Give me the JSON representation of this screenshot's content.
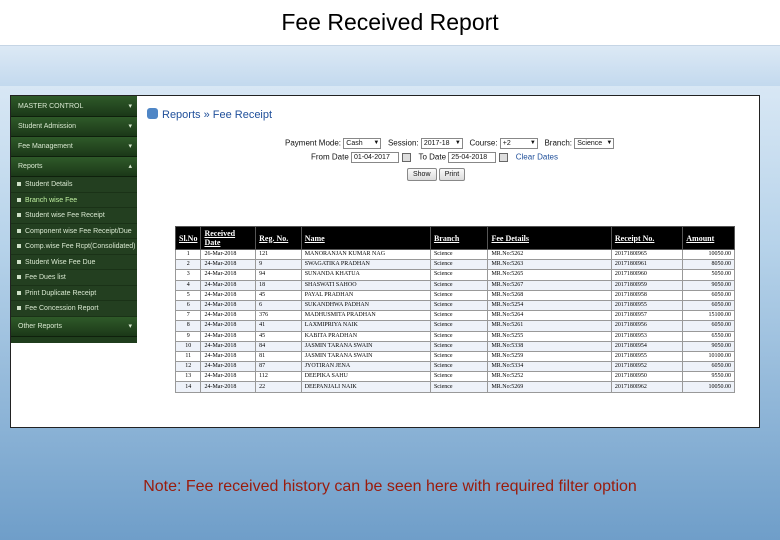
{
  "slide": {
    "title": "Fee Received Report",
    "note": "Note: Fee received history can be seen here with required filter option"
  },
  "sidebar": {
    "sections": [
      {
        "label": "MASTER CONTROL"
      },
      {
        "label": "Student Admission"
      },
      {
        "label": "Fee Management"
      },
      {
        "label": "Reports"
      }
    ],
    "report_items": [
      "Student Details",
      "Branch wise Fee",
      "Student wise Fee Receipt",
      "Component wise Fee Receipt/Due",
      "Comp.wise Fee Rcpt(Consolidated)",
      "Student Wise Fee Due",
      "Fee Dues list",
      "Print Duplicate Receipt",
      "Fee Concession Report"
    ],
    "other": "Other Reports"
  },
  "breadcrumb": "Reports » Fee Receipt",
  "filters": {
    "payment_mode_label": "Payment Mode:",
    "payment_mode_value": "Cash",
    "session_label": "Session:",
    "session_value": "2017-18",
    "course_label": "Course:",
    "course_value": "+2",
    "branch_label": "Branch:",
    "branch_value": "Science",
    "from_date_label": "From Date",
    "from_date_value": "01-04-2017",
    "to_date_label": "To Date",
    "to_date_value": "25-04-2018",
    "clear_dates": "Clear Dates",
    "show_button": "Show",
    "print_button": "Print"
  },
  "table": {
    "headers": [
      "Sl.No",
      "Received Date",
      "Reg. No.",
      "Name",
      "Branch",
      "Fee Details",
      "Receipt No.",
      "Amount"
    ],
    "rows": [
      [
        "1",
        "26-Mar-2018",
        "121",
        "MANORANJAN KUMAR NAG",
        "Science",
        "MR.No:5262",
        "2017180I965",
        "10050.00"
      ],
      [
        "2",
        "24-Mar-2018",
        "9",
        "SWAGATIKA PRADHAN",
        "Science",
        "MR.No:5263",
        "2017180I961",
        "8050.00"
      ],
      [
        "3",
        "24-Mar-2018",
        "94",
        "SUNANDA KHATUA",
        "Science",
        "MR.No:5265",
        "2017180I960",
        "5050.00"
      ],
      [
        "4",
        "24-Mar-2018",
        "18",
        "SHASWATI SAHOO",
        "Science",
        "MR.No:5267",
        "2017180I959",
        "9050.00"
      ],
      [
        "5",
        "24-Mar-2018",
        "45",
        "PAYAL PRADHAN",
        "Science",
        "MR.No:5268",
        "2017180I958",
        "6050.00"
      ],
      [
        "6",
        "24-Mar-2018",
        "6",
        "SUKANDHWA PADHAN",
        "Science",
        "MR.No:5254",
        "2017180I955",
        "6050.00"
      ],
      [
        "7",
        "24-Mar-2018",
        "376",
        "MADHUSMITA PRADHAN",
        "Science",
        "MR.No:5264",
        "2017180I957",
        "15100.00"
      ],
      [
        "8",
        "24-Mar-2018",
        "41",
        "LAXMIPRIYA NAIK",
        "Science",
        "MR.No:5261",
        "2017180I956",
        "6050.00"
      ],
      [
        "9",
        "24-Mar-2018",
        "45",
        "KABITA PRADHAN",
        "Science",
        "MR.No:5255",
        "2017180I953",
        "6550.00"
      ],
      [
        "10",
        "24-Mar-2018",
        "84",
        "JASMIN TARANA SWAIN",
        "Science",
        "MR.No:5338",
        "2017180I954",
        "9050.00"
      ],
      [
        "11",
        "24-Mar-2018",
        "81",
        "JASMIN TARANA SWAIN",
        "Science",
        "MR.No:5259",
        "2017180I955",
        "10100.00"
      ],
      [
        "12",
        "24-Mar-2018",
        "87",
        "JYOTIRAN JENA",
        "Science",
        "MR.No:5334",
        "2017180I952",
        "6050.00"
      ],
      [
        "13",
        "24-Mar-2018",
        "112",
        "DEEPIKA SAHU",
        "Science",
        "MR.No:5252",
        "2017180I950",
        "9550.00"
      ],
      [
        "14",
        "24-Mar-2018",
        "22",
        "DEEPANJALI NAIK",
        "Science",
        "MR.No:5269",
        "2017180I962",
        "10050.00"
      ]
    ]
  }
}
